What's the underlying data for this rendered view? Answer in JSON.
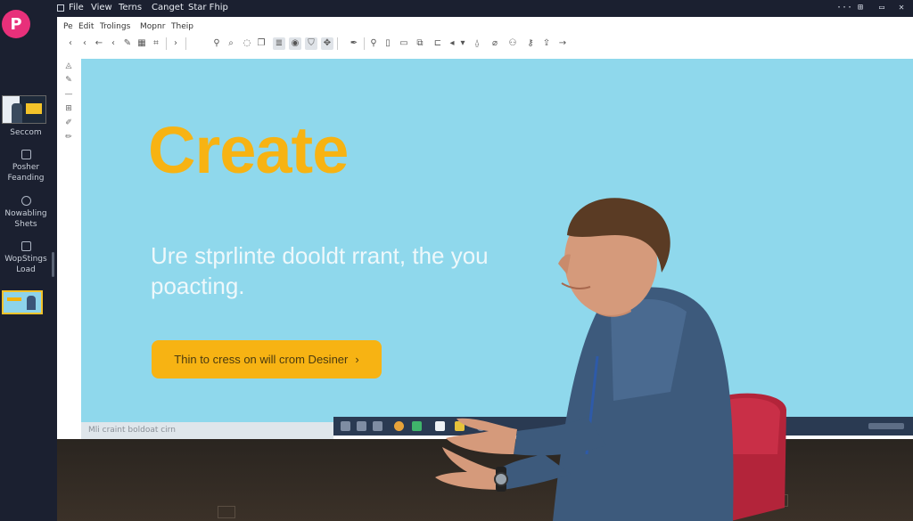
{
  "app": {
    "logo_letter": "P"
  },
  "menubar": {
    "items": [
      "File",
      "View",
      "Terns",
      "Canget",
      "Star Fhip"
    ],
    "controls": [
      "···",
      "⊞",
      "▭",
      "✕"
    ]
  },
  "submenu": {
    "items": [
      "Pe",
      "Edit",
      "Trolings",
      "Mopnr",
      "Theip"
    ]
  },
  "sidebar": {
    "items": [
      {
        "label": "Seccom"
      },
      {
        "label1": "Posher",
        "label2": "Feanding"
      },
      {
        "label1": "Nowabling",
        "label2": "Shets"
      },
      {
        "label1": "WopStings",
        "label2": "Load"
      }
    ]
  },
  "toolbar": {
    "icons": [
      "chevron-left",
      "chevron-left",
      "arrow-left",
      "chevron-left",
      "pencil",
      "grid",
      "crop",
      "chevron-right",
      "pin",
      "search",
      "comment",
      "copy",
      "list",
      "play",
      "shield",
      "move",
      "pen",
      "link",
      "file",
      "image",
      "layers",
      "cursor",
      "chevron-down",
      "lock",
      "clip",
      "person",
      "key",
      "share",
      "arrow-right"
    ]
  },
  "slide": {
    "title": "Create",
    "subtitle": "Ure stprlinte dooldt rrant, the you poacting.",
    "cta_label": "Thin to cress on will crom Desiner",
    "cta_chevron": "›",
    "bg_color": "#8fd8ec",
    "accent_color": "#f7b313"
  },
  "status": {
    "left_text": "Mli craint boldoat cirn"
  }
}
